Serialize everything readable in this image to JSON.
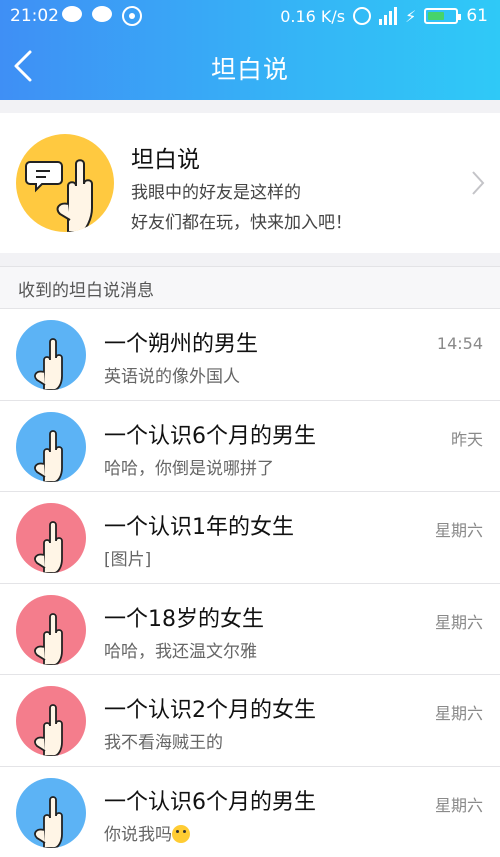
{
  "status_bar": {
    "time": "21:02",
    "speed": "0.16 K/s",
    "battery": "61",
    "battery_level": 0.61,
    "icons": [
      "chat-bubble-icon",
      "chat-bubble-icon",
      "network-icon",
      "alarm-clock-icon",
      "signal-icon",
      "charging-icon",
      "battery-icon"
    ]
  },
  "header": {
    "title": "坦白说",
    "back_icon": "back-chevron-icon"
  },
  "promo": {
    "title": "坦白说",
    "line1": "我眼中的好友是这样的",
    "line2": "好友们都在玩，快来加入吧！",
    "avatar_color": "#ffc940"
  },
  "section": {
    "label": "收到的坦白说消息"
  },
  "messages": [
    {
      "name": "一个朔州的男生",
      "message": "英语说的像外国人",
      "time": "14:54",
      "avatar": "male"
    },
    {
      "name": "一个认识6个月的男生",
      "message": "哈哈，你倒是说哪拼了",
      "time": "昨天",
      "avatar": "male"
    },
    {
      "name": "一个认识1年的女生",
      "message": "[图片]",
      "time": "星期六",
      "avatar": "female"
    },
    {
      "name": "一个18岁的女生",
      "message": "哈哈，我还温文尔雅",
      "time": "星期六",
      "avatar": "female"
    },
    {
      "name": "一个认识2个月的女生",
      "message": "我不看海贼王的",
      "time": "星期六",
      "avatar": "female"
    },
    {
      "name": "一个认识6个月的男生",
      "message": "你说我吗",
      "time": "星期六",
      "avatar": "male",
      "emoji": "laughing-emoji"
    }
  ],
  "colors": {
    "header_start": "#3f8ff5",
    "header_end": "#2fc9f7",
    "male_avatar": "#5cb3f5",
    "female_avatar": "#f47d8c"
  }
}
